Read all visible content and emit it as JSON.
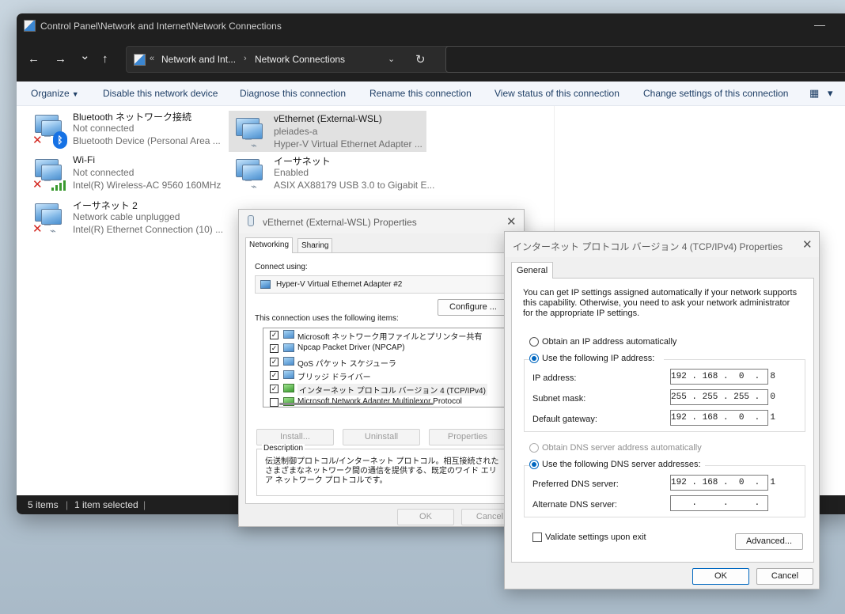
{
  "explorer": {
    "title": "Control Panel\\Network and Internet\\Network Connections",
    "minimize_glyph": "—",
    "nav": {
      "back": "←",
      "forward": "→",
      "recent": "⌄",
      "up": "↑"
    },
    "address": {
      "overflow": "«",
      "crumb1": "Network and Int...",
      "separator": "›",
      "crumb2": "Network Connections",
      "dropdown": "⌄",
      "refresh": "↻"
    },
    "toolbar": {
      "organize": "Organize",
      "disable": "Disable this network device",
      "diagnose": "Diagnose this connection",
      "rename": "Rename this connection",
      "view_status": "View status of this connection",
      "change_settings": "Change settings of this connection",
      "view_icon": "▦",
      "more": "▾"
    },
    "connections": [
      {
        "name": "Bluetooth ネットワーク接続",
        "status": "Not connected",
        "device": "Bluetooth Device (Personal Area ..."
      },
      {
        "name": "vEthernet (External-WSL)",
        "status": "pleiades-a",
        "device": "Hyper-V Virtual Ethernet Adapter ..."
      },
      {
        "name": "Wi-Fi",
        "status": "Not connected",
        "device": "Intel(R) Wireless-AC 9560 160MHz"
      },
      {
        "name": "イーサネット",
        "status": "Enabled",
        "device": "ASIX AX88179 USB 3.0 to Gigabit E..."
      },
      {
        "name": "イーサネット 2",
        "status": "Network cable unplugged",
        "device": "Intel(R) Ethernet Connection (10) ..."
      }
    ],
    "status_bar": {
      "count": "5 items",
      "separator": "|",
      "selected": "1 item selected",
      "separator2": "|"
    }
  },
  "properties": {
    "title": "vEthernet (External-WSL) Properties",
    "close": "✕",
    "tabs": [
      "Networking",
      "Sharing"
    ],
    "connect_using_label": "Connect using:",
    "adapter": "Hyper-V Virtual Ethernet Adapter #2",
    "configure": "Configure ...",
    "items_label": "This connection uses the following items:",
    "items": [
      {
        "label": "Microsoft ネットワーク用ファイルとプリンター共有",
        "checked": "✓"
      },
      {
        "label": "Npcap Packet Driver (NPCAP)",
        "checked": "✓"
      },
      {
        "label": "QoS パケット スケジューラ",
        "checked": "✓"
      },
      {
        "label": "ブリッジ ドライバー",
        "checked": "✓"
      },
      {
        "label": "インターネット プロトコル バージョン 4 (TCP/IPv4)",
        "checked": "✓"
      },
      {
        "label": "Microsoft Network Adapter Multiplexor Protocol",
        "checked": ""
      }
    ],
    "install": "Install...",
    "uninstall": "Uninstall",
    "properties_btn": "Properties",
    "description_label": "Description",
    "description": "伝送制御プロトコル/インターネット プロトコル。相互接続されたさまざまなネットワーク間の通信を提供する、既定のワイド エリア ネットワーク プロトコルです。",
    "ok": "OK",
    "cancel": "Cancel"
  },
  "ipv4": {
    "title": "インターネット プロトコル バージョン 4 (TCP/IPv4) Properties",
    "close": "✕",
    "tab": "General",
    "intro": "You can get IP settings assigned automatically if your network supports this capability. Otherwise, you need to ask your network administrator for the appropriate IP settings.",
    "obtain_ip_auto": "Obtain an IP address automatically",
    "use_following_ip": "Use the following IP address:",
    "ip_label": "IP address:",
    "ip_value": "192 . 168 .  0  .  8",
    "subnet_label": "Subnet mask:",
    "subnet_value": "255 . 255 . 255 .  0",
    "gateway_label": "Default gateway:",
    "gateway_value": "192 . 168 .  0  .  1",
    "obtain_dns_auto": "Obtain DNS server address automatically",
    "use_following_dns": "Use the following DNS server addresses:",
    "preferred_dns_label": "Preferred DNS server:",
    "preferred_dns_value": "192 . 168 .  0  .  1",
    "alternate_dns_label": "Alternate DNS server:",
    "alternate_dns_value": "    .     .     .    ",
    "validate": "Validate settings upon exit",
    "advanced": "Advanced...",
    "ok": "OK",
    "cancel": "Cancel"
  }
}
